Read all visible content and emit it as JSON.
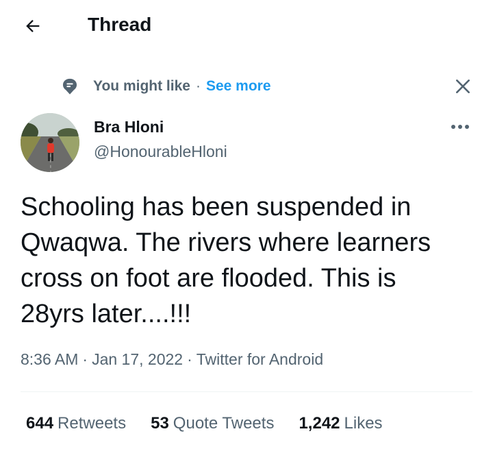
{
  "header": {
    "title": "Thread",
    "back_icon": "arrow-left-icon"
  },
  "suggestion": {
    "label": "You might like",
    "separator": "·",
    "see_more": "See more",
    "icon": "chat-bubble-icon"
  },
  "tweet": {
    "display_name": "Bra Hloni",
    "handle": "@HonourableHloni",
    "text": "Schooling has been suspended in\nQwaqwa. The rivers where learners\ncross on foot are flooded. This is\n28yrs later....!!!",
    "time": "8:36 AM",
    "date": "Jan 17, 2022",
    "source": "Twitter for Android",
    "separator": "·"
  },
  "stats": {
    "retweets_count": "644",
    "retweets_label": "Retweets",
    "quotes_count": "53",
    "quotes_label": "Quote Tweets",
    "likes_count": "1,242",
    "likes_label": "Likes"
  },
  "colors": {
    "accent": "#1d9bf0",
    "text_primary": "#0f1419",
    "text_secondary": "#536471",
    "divider": "#eff3f4"
  }
}
